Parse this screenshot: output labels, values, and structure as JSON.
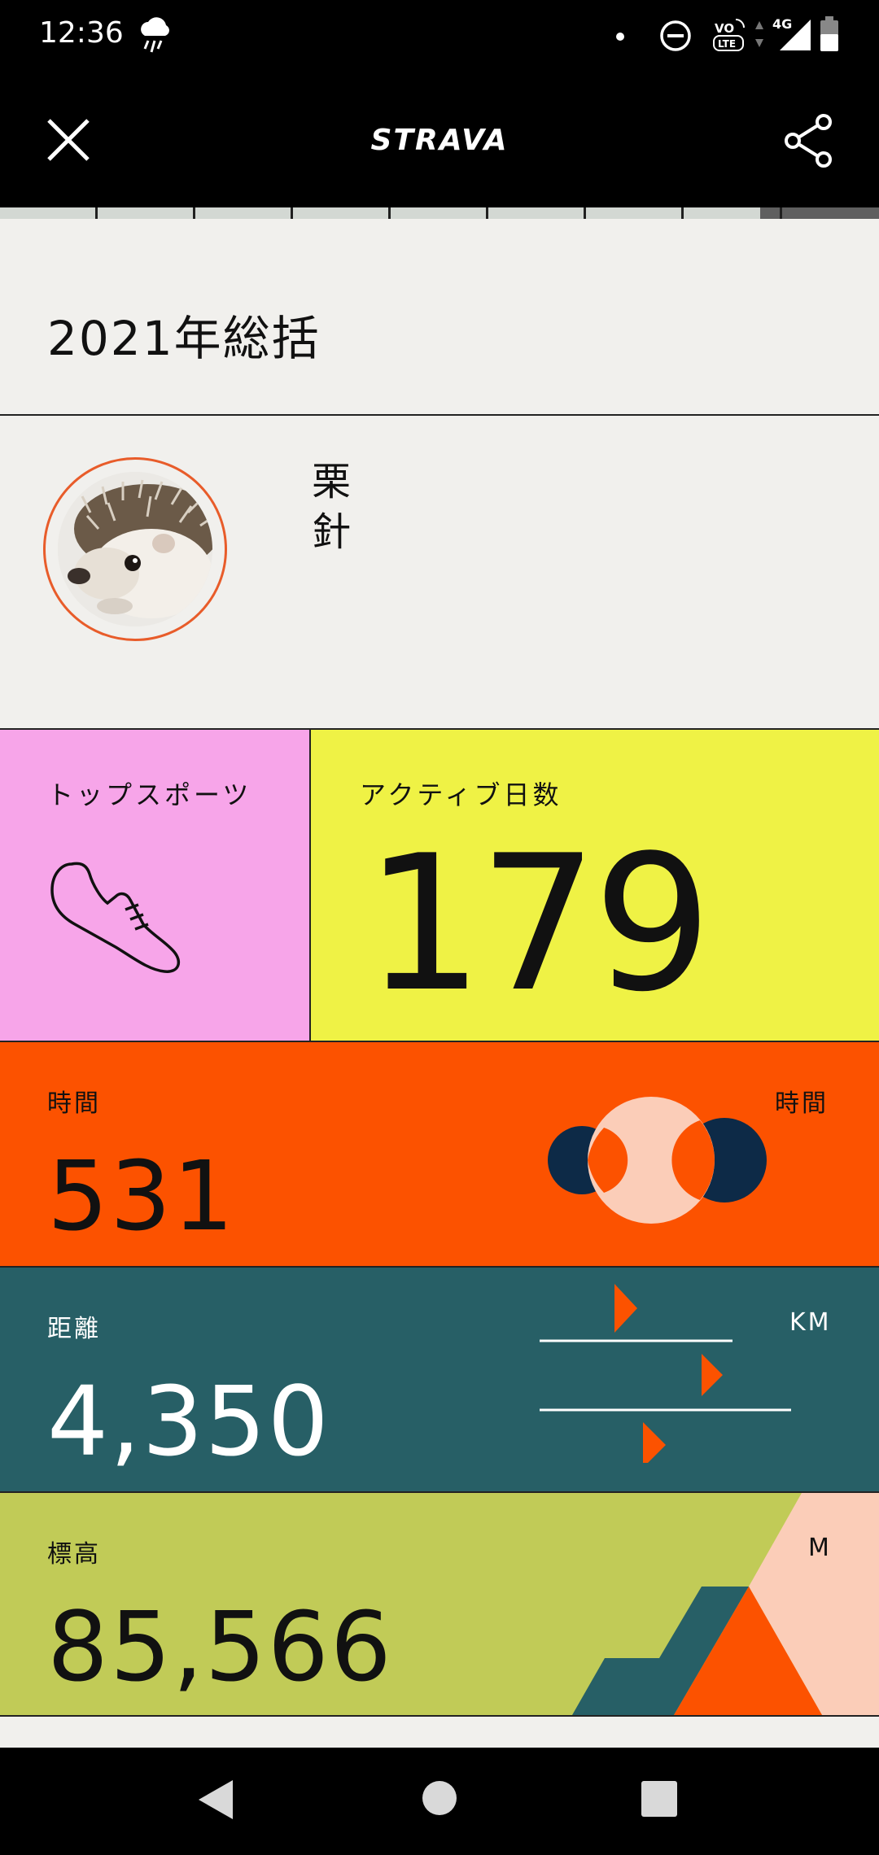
{
  "status_bar": {
    "time": "12:36",
    "weather_icon": "rain-cloud-icon",
    "network": "4G",
    "volte": "VO LTE"
  },
  "header": {
    "brand": "STRAVA",
    "close_icon": "close-icon",
    "share_icon": "share-icon"
  },
  "story": {
    "segments": 9,
    "current_segment": 9
  },
  "summary": {
    "title": "2021年総括",
    "athlete_name": "栗針"
  },
  "tiles": {
    "top_sport": {
      "label": "トップスポーツ",
      "icon": "running-shoe-icon"
    },
    "active_days": {
      "label": "アクティブ日数",
      "value": "179"
    },
    "time": {
      "label": "時間",
      "value": "531",
      "unit": "時間"
    },
    "distance": {
      "label": "距離",
      "value": "4,350",
      "unit": "KM"
    },
    "elevation": {
      "label": "標高",
      "value": "85,566",
      "unit": "M"
    }
  },
  "colors": {
    "pink": "#f7a5e9",
    "yellow": "#eff245",
    "orange": "#fc5200",
    "teal": "#275f66",
    "olive": "#c1cb57",
    "peach": "#fbcdb8",
    "navy": "#0d2a47"
  },
  "nav": {
    "back": "back-icon",
    "home": "home-icon",
    "recents": "recents-icon"
  }
}
